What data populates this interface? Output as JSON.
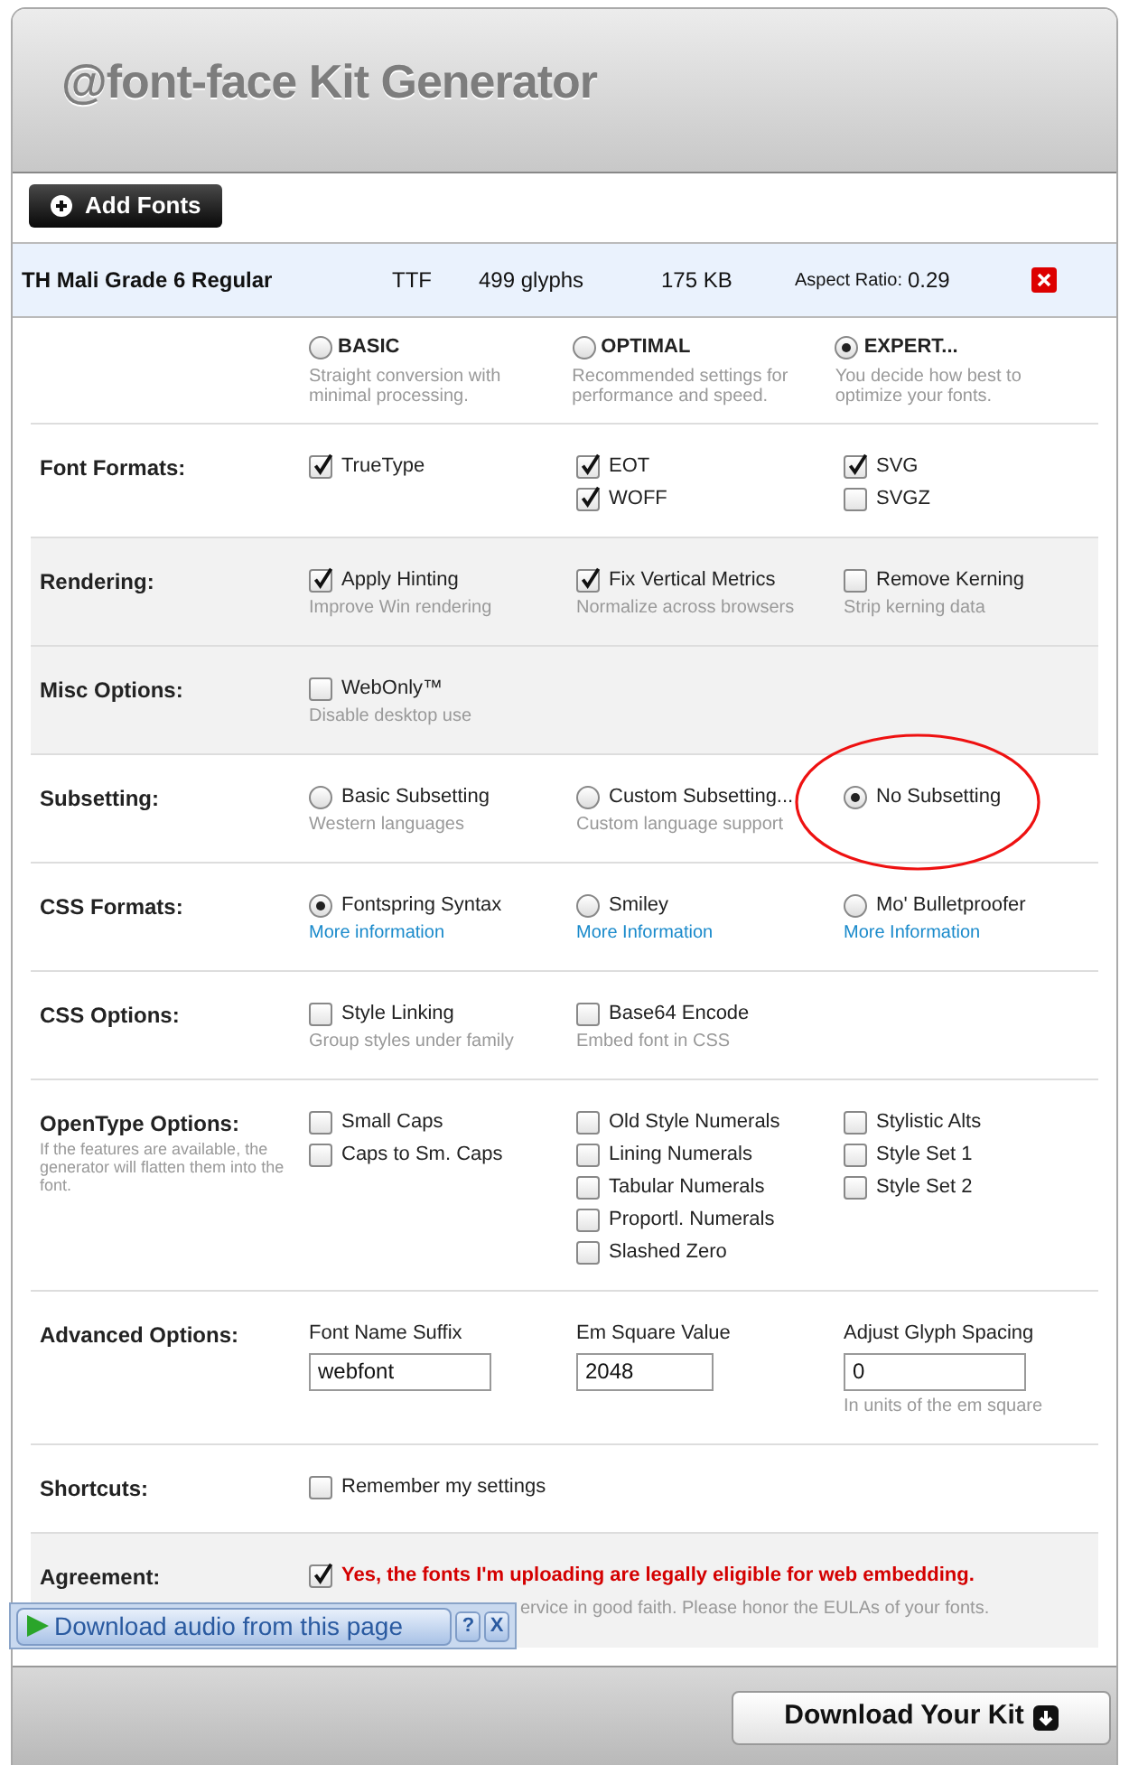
{
  "header": {
    "title": "@font-face Kit Generator"
  },
  "add_button": {
    "label": "Add Fonts"
  },
  "font_row": {
    "name": "TH Mali Grade 6 Regular",
    "format": "TTF",
    "glyphs": "499 glyphs",
    "size": "175 KB",
    "aspect_label": "Aspect Ratio:",
    "aspect_value": "0.29"
  },
  "modes": [
    {
      "label": "BASIC",
      "hint": "Straight conversion with minimal processing.",
      "selected": false
    },
    {
      "label": "OPTIMAL",
      "hint": "Recommended settings for performance and speed.",
      "selected": false
    },
    {
      "label": "EXPERT...",
      "hint": "You decide how best to optimize your fonts.",
      "selected": true
    }
  ],
  "sections": [
    {
      "label": "Font Formats:",
      "kind": "options",
      "shaded": false,
      "columns": [
        [
          {
            "kind": "checkbox",
            "label": "TrueType",
            "checked": true
          }
        ],
        [
          {
            "kind": "checkbox",
            "label": "EOT",
            "checked": true
          },
          {
            "kind": "checkbox",
            "label": "WOFF",
            "checked": true
          }
        ],
        [
          {
            "kind": "checkbox",
            "label": "SVG",
            "checked": true
          },
          {
            "kind": "checkbox",
            "label": "SVGZ",
            "checked": false
          }
        ]
      ]
    },
    {
      "label": "Rendering:",
      "kind": "options",
      "shaded": true,
      "columns": [
        [
          {
            "kind": "checkbox",
            "label": "Apply Hinting",
            "checked": true,
            "hint": "Improve Win rendering"
          }
        ],
        [
          {
            "kind": "checkbox",
            "label": "Fix Vertical Metrics",
            "checked": true,
            "hint": "Normalize across browsers"
          }
        ],
        [
          {
            "kind": "checkbox",
            "label": "Remove Kerning",
            "checked": false,
            "hint": "Strip kerning data"
          }
        ]
      ]
    },
    {
      "label": "Misc Options:",
      "kind": "options",
      "shaded": true,
      "columns": [
        [
          {
            "kind": "checkbox",
            "label": "WebOnly™",
            "checked": false,
            "hint": "Disable desktop use"
          }
        ]
      ]
    },
    {
      "label": "Subsetting:",
      "kind": "options",
      "shaded": false,
      "columns": [
        [
          {
            "kind": "radio",
            "label": "Basic Subsetting",
            "selected": false,
            "circled": false,
            "hint": "Western languages"
          }
        ],
        [
          {
            "kind": "radio",
            "label": "Custom Subsetting...",
            "selected": false,
            "circled": false,
            "hint": "Custom language support"
          }
        ],
        [
          {
            "kind": "radio",
            "label": "No Subsetting",
            "selected": true,
            "circled": true
          }
        ]
      ]
    },
    {
      "label": "CSS Formats:",
      "kind": "options",
      "shaded": false,
      "columns": [
        [
          {
            "kind": "radio",
            "label": "Fontspring Syntax",
            "selected": true,
            "link": "More information"
          }
        ],
        [
          {
            "kind": "radio",
            "label": "Smiley",
            "selected": false,
            "link": "More Information"
          }
        ],
        [
          {
            "kind": "radio",
            "label": "Mo' Bulletproofer",
            "selected": false,
            "link": "More Information"
          }
        ]
      ]
    },
    {
      "label": "CSS Options:",
      "kind": "options",
      "shaded": false,
      "columns": [
        [
          {
            "kind": "checkbox",
            "label": "Style Linking",
            "checked": false,
            "hint": "Group styles under family"
          }
        ],
        [
          {
            "kind": "checkbox",
            "label": "Base64 Encode",
            "checked": false,
            "hint": "Embed font in CSS"
          }
        ]
      ]
    },
    {
      "label": "OpenType Options:",
      "kind": "options",
      "shaded": false,
      "note": "If the features are available, the generator will flatten them into the font.",
      "columns": [
        [
          {
            "kind": "checkbox",
            "label": "Small Caps",
            "checked": false
          },
          {
            "kind": "checkbox",
            "label": "Caps to Sm. Caps",
            "checked": false
          }
        ],
        [
          {
            "kind": "checkbox",
            "label": "Old Style Numerals",
            "checked": false
          },
          {
            "kind": "checkbox",
            "label": "Lining Numerals",
            "checked": false
          },
          {
            "kind": "checkbox",
            "label": "Tabular Numerals",
            "checked": false
          },
          {
            "kind": "checkbox",
            "label": "Proportl. Numerals",
            "checked": false
          },
          {
            "kind": "checkbox",
            "label": "Slashed Zero",
            "checked": false
          }
        ],
        [
          {
            "kind": "checkbox",
            "label": "Stylistic Alts",
            "checked": false
          },
          {
            "kind": "checkbox",
            "label": "Style Set 1",
            "checked": false
          },
          {
            "kind": "checkbox",
            "label": "Style Set 2",
            "checked": false
          }
        ]
      ]
    },
    {
      "label": "Advanced Options:",
      "kind": "fields",
      "shaded": false,
      "fields": [
        {
          "label": "Font Name Suffix",
          "value": "webfont"
        },
        {
          "label": "Em Square Value",
          "value": "2048"
        },
        {
          "label": "Adjust Glyph Spacing",
          "value": "0",
          "hint": "In units of the em square"
        }
      ]
    },
    {
      "label": "Shortcuts:",
      "kind": "options",
      "shaded": false,
      "columns": [
        [
          {
            "kind": "checkbox",
            "label": "Remember my settings",
            "checked": false
          }
        ]
      ]
    },
    {
      "label": "Agreement:",
      "kind": "agreement",
      "shaded": true,
      "option": {
        "label": "Yes, the fonts I'm uploading are legally eligible for web embedding.",
        "checked": true
      },
      "disclaimer": "ervice in good faith. Please honor the EULAs of your fonts."
    }
  ],
  "download_button": {
    "label": "Download Your Kit"
  },
  "audio_bar": {
    "label": "Download audio from this page",
    "help": "?",
    "close": "X"
  }
}
